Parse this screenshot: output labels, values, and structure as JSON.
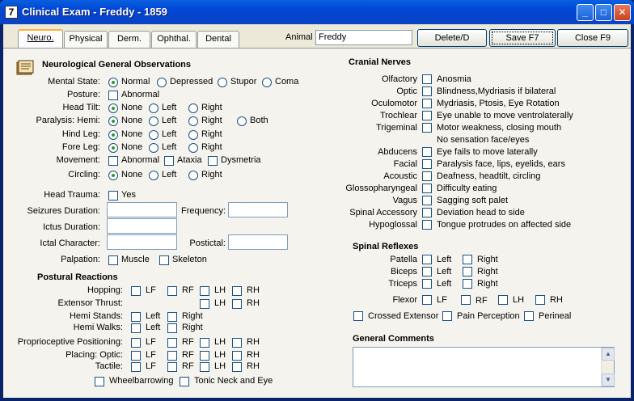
{
  "window": {
    "title": "Clinical Exam - Freddy - 1859",
    "app_icon": "7"
  },
  "tabs": [
    "Neuro.",
    "Physical",
    "Derm.",
    "Ophthal.",
    "Dental"
  ],
  "animal": {
    "label": "Animal",
    "value": "Freddy"
  },
  "buttons": {
    "delete": "Delete/D",
    "save": "Save F7",
    "close": "Close F9"
  },
  "neuro": {
    "heading": "Neurological General Observations",
    "mental_state": {
      "label": "Mental State:",
      "options": [
        "Normal",
        "Depressed",
        "Stupor",
        "Coma"
      ]
    },
    "posture": {
      "label": "Posture:",
      "option": "Abnormal"
    },
    "head_tilt": {
      "label": "Head Tilt:",
      "options": [
        "None",
        "Left",
        "Right"
      ]
    },
    "paralysis": {
      "label": "Paralysis: Hemi:",
      "options": [
        "None",
        "Left",
        "Right",
        "Both"
      ]
    },
    "hind_leg": {
      "label": "Hind Leg:",
      "options": [
        "None",
        "Left",
        "Right"
      ]
    },
    "fore_leg": {
      "label": "Fore Leg:",
      "options": [
        "None",
        "Left",
        "Right"
      ]
    },
    "movement": {
      "label": "Movement:",
      "options": [
        "Abnormal",
        "Ataxia",
        "Dysmetria"
      ]
    },
    "circling": {
      "label": "Circling:",
      "options": [
        "None",
        "Left",
        "Right"
      ]
    },
    "head_trauma": {
      "label": "Head Trauma:",
      "option": "Yes"
    },
    "seizures_duration": "Seizures Duration:",
    "frequency": "Frequency:",
    "ictus_duration": "Ictus Duration:",
    "ictal_character": "Ictal Character:",
    "postictal": "Postictal:",
    "palpation": {
      "label": "Palpation:",
      "options": [
        "Muscle",
        "Skeleton"
      ]
    }
  },
  "postural": {
    "heading": "Postural Reactions",
    "hopping": "Hopping:",
    "extensor_thrust": "Extensor Thrust:",
    "hemi_stands": "Hemi Stands:",
    "hemi_walks": "Hemi Walks:",
    "proprioceptive": "Proprioceptive Positioning:",
    "placing_optic": "Placing: Optic:",
    "tactile": "Tactile:",
    "legs": [
      "LF",
      "RF",
      "LH",
      "RH"
    ],
    "sides": [
      "Left",
      "Right"
    ],
    "wheelbarrowing": "Wheelbarrowing",
    "tonic_neck": "Tonic Neck and Eye"
  },
  "cranial": {
    "heading": "Cranial Nerves",
    "items": [
      {
        "nerve": "Olfactory",
        "finding": "Anosmia"
      },
      {
        "nerve": "Optic",
        "finding": "Blindness,Mydriasis if bilateral"
      },
      {
        "nerve": "Oculomotor",
        "finding": "Mydriasis, Ptosis, Eye Rotation"
      },
      {
        "nerve": "Trochlear",
        "finding": "Eye unable to move ventrolaterally"
      },
      {
        "nerve": "Trigeminal",
        "finding": "Motor weakness, closing mouth",
        "extra": "No sensation face/eyes"
      },
      {
        "nerve": "Abducens",
        "finding": "Eye fails to move laterally"
      },
      {
        "nerve": "Facial",
        "finding": "Paralysis face, lips, eyelids, ears"
      },
      {
        "nerve": "Acoustic",
        "finding": "Deafness, headtilt, circling"
      },
      {
        "nerve": "Glossopharyngeal",
        "finding": "Difficulty eating"
      },
      {
        "nerve": "Vagus",
        "finding": "Sagging soft palet"
      },
      {
        "nerve": "Spinal Accessory",
        "finding": "Deviation head to side"
      },
      {
        "nerve": "Hypoglossal",
        "finding": "Tongue protrudes on affected side"
      }
    ]
  },
  "spinal": {
    "heading": "Spinal Reflexes",
    "patella": "Patella",
    "biceps": "Biceps",
    "triceps": "Triceps",
    "flexor": "Flexor",
    "sides": [
      "Left",
      "Right"
    ],
    "legs": [
      "LF",
      "RF",
      "LH",
      "RH"
    ],
    "crossed_extensor": "Crossed Extensor",
    "pain_perception": "Pain Perception",
    "perineal": "Perineal"
  },
  "comments": {
    "heading": "General Comments"
  }
}
